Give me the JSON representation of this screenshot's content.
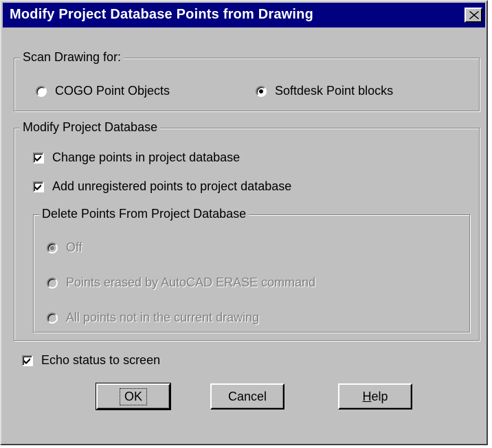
{
  "dialog": {
    "title": "Modify Project Database Points from Drawing"
  },
  "scan_group": {
    "label": "Scan Drawing for:",
    "options": [
      {
        "label": "COGO Point Objects",
        "selected": false
      },
      {
        "label": "Softdesk Point blocks",
        "selected": true
      }
    ]
  },
  "modify_group": {
    "label": "Modify Project Database",
    "checkboxes": [
      {
        "label": "Change points in project database",
        "checked": true
      },
      {
        "label": "Add unregistered points to project database",
        "checked": true
      }
    ],
    "delete_group": {
      "label": "Delete Points From Project Database",
      "enabled": false,
      "options": [
        {
          "label": "Off",
          "selected": true
        },
        {
          "label": "Points erased by AutoCAD ERASE command",
          "selected": false
        },
        {
          "label": "All points not in the current drawing",
          "selected": false
        }
      ]
    }
  },
  "echo_status": {
    "label": "Echo status to screen",
    "checked": true
  },
  "buttons": {
    "ok": "OK",
    "cancel": "Cancel",
    "help_first": "H",
    "help_rest": "elp"
  },
  "icons": {
    "close": "close-icon",
    "check": "checkmark-icon"
  }
}
